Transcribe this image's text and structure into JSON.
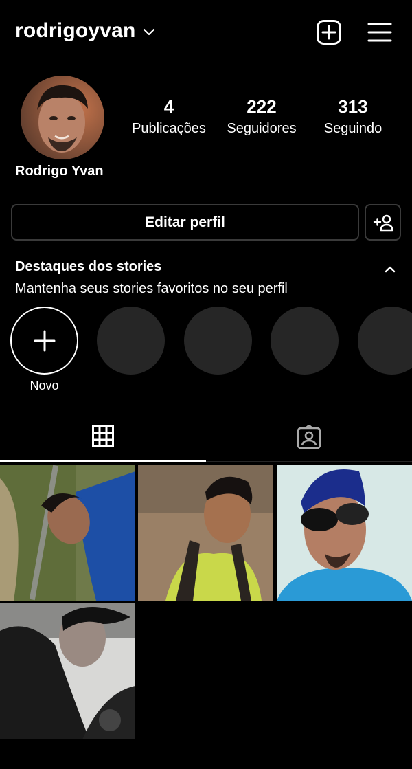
{
  "header": {
    "username": "rodrigoyvan",
    "icons": {
      "switch_account": "chevron-down-icon",
      "create": "add-post-icon",
      "menu": "hamburger-menu-icon"
    }
  },
  "profile": {
    "full_name": "Rodrigo Yvan",
    "stats": {
      "posts": {
        "count": "4",
        "label": "Publicações"
      },
      "followers": {
        "count": "222",
        "label": "Seguidores"
      },
      "following": {
        "count": "313",
        "label": "Seguindo"
      }
    }
  },
  "actions": {
    "edit_profile": "Editar perfil",
    "discover_people_icon": "add-user-icon"
  },
  "highlights": {
    "title": "Destaques dos stories",
    "subtitle": "Mantenha seus stories favoritos no seu perfil",
    "new_label": "Novo"
  },
  "tabs": [
    {
      "name": "posts-grid",
      "icon": "grid-icon",
      "active": true
    },
    {
      "name": "tagged",
      "icon": "tagged-person-icon",
      "active": false
    }
  ],
  "colors": {
    "background": "#000000",
    "text": "#ffffff",
    "border": "#3a3a3a",
    "placeholder": "#262626"
  }
}
